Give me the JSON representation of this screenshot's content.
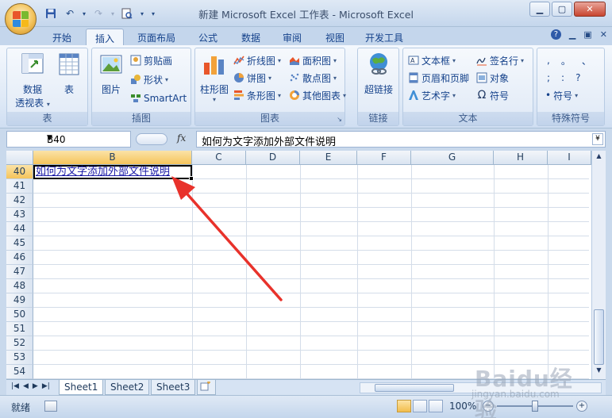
{
  "window": {
    "title": "新建 Microsoft Excel 工作表 - Microsoft Excel"
  },
  "ribbon_tabs": [
    "开始",
    "插入",
    "页面布局",
    "公式",
    "数据",
    "审阅",
    "视图",
    "开发工具"
  ],
  "active_tab": "插入",
  "groups": {
    "table": {
      "label": "表",
      "pivot_line1": "数据",
      "pivot_line2": "透视表",
      "table": "表"
    },
    "illustrations": {
      "label": "插图",
      "picture": "图片",
      "clipart": "剪贴画",
      "shapes": "形状",
      "smartart": "SmartArt"
    },
    "charts": {
      "label": "图表",
      "column": "柱形图",
      "line": "折线图",
      "pie": "饼图",
      "bar": "条形图",
      "area": "面积图",
      "scatter": "散点图",
      "other": "其他图表"
    },
    "links": {
      "label": "链接",
      "hyperlink": "超链接"
    },
    "text": {
      "label": "文本",
      "textbox": "文本框",
      "header_footer": "页眉和页脚",
      "wordart": "艺术字",
      "signature": "签名行",
      "object": "对象",
      "symbol": "符号"
    },
    "special": {
      "label": "特殊符号",
      "r1a": ",",
      "r1b": "。",
      "r1c": "、",
      "r2a": ";",
      "r2b": ":",
      "r2c": "?",
      "symbol": "符号"
    }
  },
  "formula_bar": {
    "name_box": "B40",
    "fx": "fx",
    "content": "如何为文字添加外部文件说明"
  },
  "columns": [
    "B",
    "C",
    "D",
    "E",
    "F",
    "G",
    "H",
    "I"
  ],
  "rows": [
    "40",
    "41",
    "42",
    "43",
    "44",
    "45",
    "46",
    "47",
    "48",
    "49",
    "50",
    "51",
    "52",
    "53",
    "54"
  ],
  "cell_b40": "如何为文字添加外部文件说明",
  "sheet_tabs": [
    "Sheet1",
    "Sheet2",
    "Sheet3"
  ],
  "status": {
    "ready": "就绪",
    "zoom": "100%",
    "zoom_level": 1.0
  },
  "watermark": {
    "text": "Baidu经验",
    "url": "jingyan.baidu.com"
  },
  "colors": {
    "accent": "#f5c45b",
    "ribbon": "#dde8f6",
    "arrow": "#e8322b",
    "link_text": "#1a1aa6"
  }
}
